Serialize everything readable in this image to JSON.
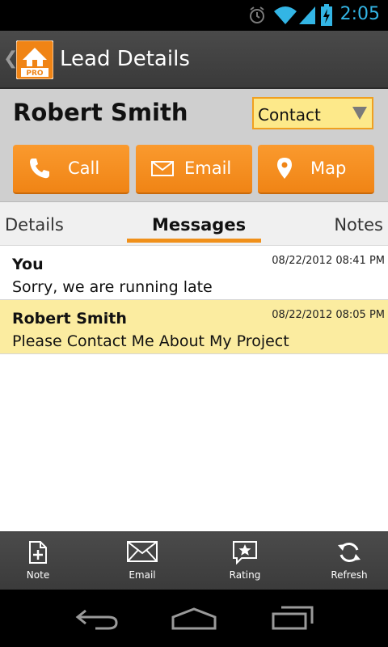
{
  "status_bar": {
    "time": "2:05",
    "icons": [
      "alarm-icon",
      "wifi-icon",
      "signal-icon",
      "battery-charging-icon"
    ],
    "accent_color": "#33b5e5"
  },
  "action_bar": {
    "title": "Lead Details",
    "logo_badge": "PRO",
    "icons": [
      "back-chevron-icon",
      "app-logo-icon"
    ]
  },
  "lead": {
    "name": "Robert Smith",
    "status": "Contact",
    "buttons": {
      "call": "Call",
      "email": "Email",
      "map": "Map"
    }
  },
  "tabs": [
    {
      "label": "Details",
      "active": false
    },
    {
      "label": "Messages",
      "active": true
    },
    {
      "label": "Notes",
      "active": false
    }
  ],
  "messages": [
    {
      "sender": "You",
      "date": "08/22/2012 08:41 PM",
      "body": "Sorry, we are running late",
      "highlighted": false
    },
    {
      "sender": "Robert Smith",
      "date": "08/22/2012 08:05 PM",
      "body": "Please Contact Me About My Project",
      "highlighted": true
    }
  ],
  "bottom_bar": {
    "note": "Note",
    "email": "Email",
    "rating": "Rating",
    "refresh": "Refresh"
  },
  "colors": {
    "accent_orange": "#f08415",
    "highlight_yellow": "#fbeca0",
    "select_yellow": "#fde98a"
  }
}
